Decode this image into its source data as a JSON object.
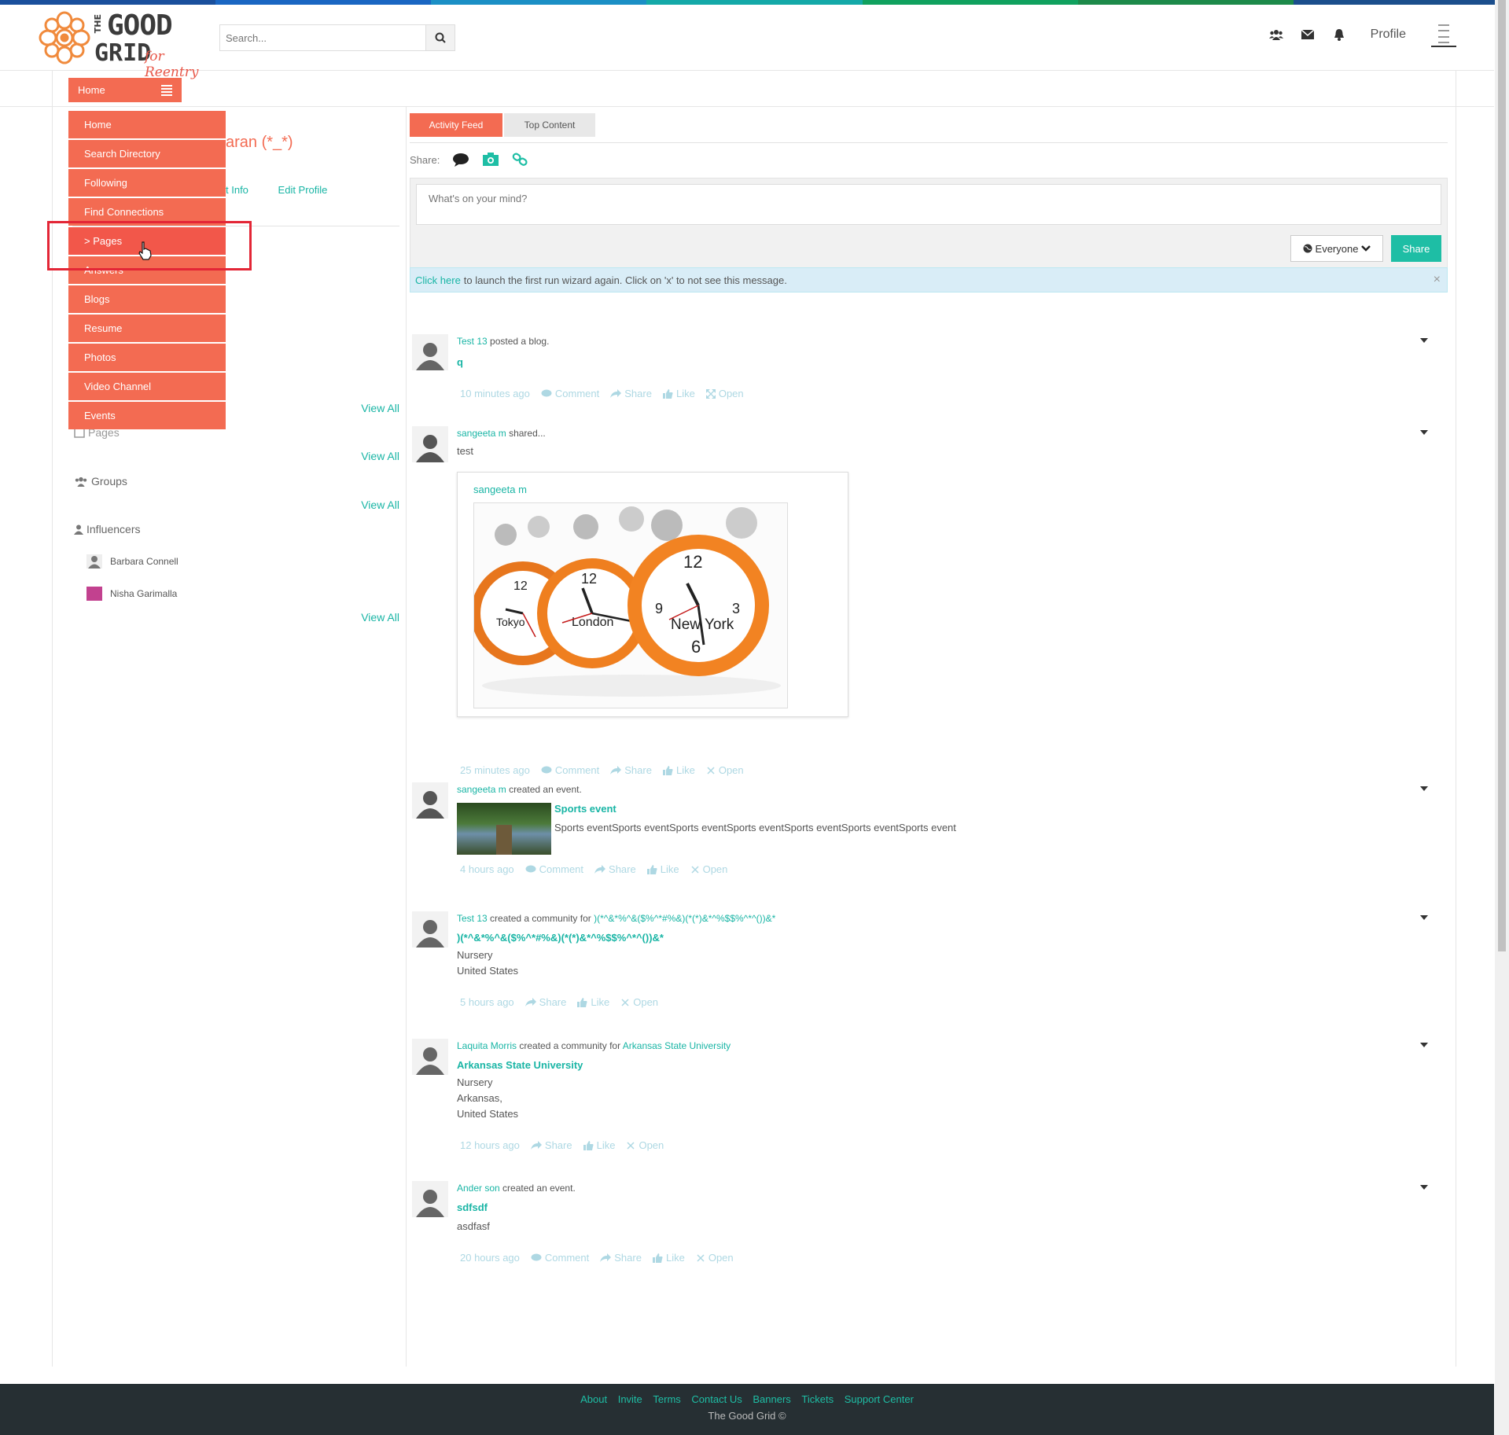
{
  "colors": {
    "accent": "#f36b52",
    "teal": "#1ebea5",
    "footer_bg": "#262f33"
  },
  "topstripe": [
    "#1a4f9c",
    "#1a66c2",
    "#1b8fc5",
    "#14a9a8",
    "#10a15e",
    "#1d8a4a",
    "#1b4e8c"
  ],
  "header": {
    "logo": {
      "the": "THE",
      "good": "GOOD",
      "grid": "GRID",
      "tagline": "for Reentry"
    },
    "search_placeholder": "Search...",
    "icons": [
      "users-icon",
      "envelope-icon",
      "bell-icon"
    ],
    "profile_label": "Profile"
  },
  "menu": {
    "toggle_label": "Home",
    "items": [
      {
        "label": "Home"
      },
      {
        "label": "Search Directory"
      },
      {
        "label": "Following"
      },
      {
        "label": "Find Connections"
      },
      {
        "label": "> Pages"
      },
      {
        "label": "Answers"
      },
      {
        "label": "Blogs"
      },
      {
        "label": "Resume"
      },
      {
        "label": "Photos"
      },
      {
        "label": "Video Channel"
      },
      {
        "label": "Events"
      }
    ]
  },
  "left": {
    "name_partial": "aran (*_*)",
    "tabs": [
      "t Info",
      "Edit Profile"
    ],
    "view_all": "View All",
    "pages_partial": "Pages",
    "groups": "Groups",
    "influencers": "Influencers",
    "influencer_list": [
      "Barbara Connell",
      "Nisha Garimalla"
    ]
  },
  "main": {
    "tabs": [
      "Activity Feed",
      "Top Content"
    ],
    "share_label": "Share:",
    "composer_placeholder": "What's on your mind?",
    "audience": "Everyone",
    "share_button": "Share",
    "wizard_link": "Click here",
    "wizard_text": "to launch the first run wizard again. Click on 'x' to not see this message.",
    "wizard_close": "×",
    "actions": {
      "comment": "Comment",
      "share": "Share",
      "like": "Like",
      "open": "Open"
    },
    "posts": [
      {
        "who": "Test 13",
        "verb": "posted a blog.",
        "title": "q",
        "time": "10 minutes ago"
      },
      {
        "who": "sangeeta m",
        "verb": "shared...",
        "body": "test",
        "card_name": "sangeeta m",
        "clock_labels": [
          "Tokyo",
          "London",
          "New York"
        ],
        "time": "25 minutes ago"
      },
      {
        "who": "sangeeta m",
        "verb": "created an event.",
        "title": "Sports event",
        "body": "Sports eventSports eventSports eventSports eventSports eventSports eventSports event",
        "time": "4 hours ago"
      },
      {
        "who": "Test 13",
        "verb": "created a community for",
        "target": ")(*^&*%^&($%^*#%&)(*(*)&*^%$$%^*^())&*",
        "title": ")(*^&*%^&($%^*#%&)(*(*)&*^%$$%^*^())&*",
        "lines": [
          "Nursery",
          "United States"
        ],
        "time": "5 hours ago"
      },
      {
        "who": "Laquita Morris",
        "verb": "created a community for",
        "target": "Arkansas State University",
        "title": "Arkansas State University",
        "lines": [
          "Nursery",
          "Arkansas,",
          "United States"
        ],
        "time": "12 hours ago"
      },
      {
        "who": "Ander son",
        "verb": "created an event.",
        "title": "sdfsdf",
        "body": "asdfasf",
        "time": "20 hours ago"
      }
    ]
  },
  "footer": {
    "links": [
      "About",
      "Invite",
      "Terms",
      "Contact Us",
      "Banners",
      "Tickets",
      "Support Center"
    ],
    "copyright": "The Good Grid ©"
  }
}
